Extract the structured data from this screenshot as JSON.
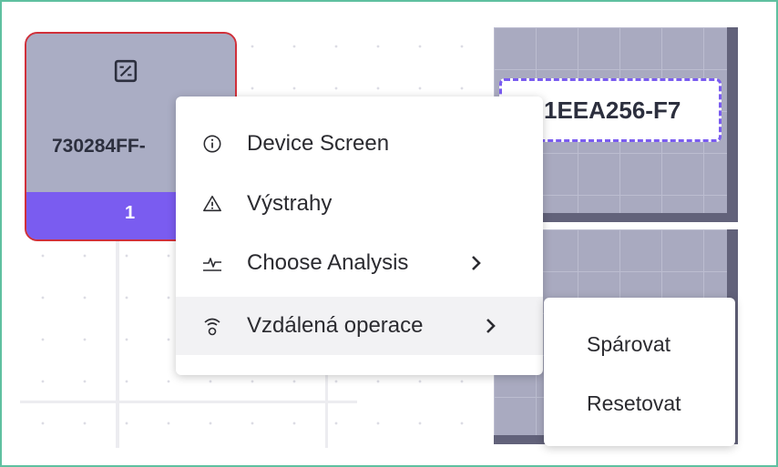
{
  "device_card": {
    "name": "730284FF-",
    "count": "1",
    "icon": "percent-box-icon"
  },
  "selected_device": {
    "label": "1EEA256-F7"
  },
  "context_menu": {
    "items": [
      {
        "label": "Device Screen",
        "icon": "info-icon"
      },
      {
        "label": "Výstrahy",
        "icon": "warning-triangle-icon"
      },
      {
        "label": "Choose Analysis",
        "icon": "analysis-pulse-icon",
        "has_submenu": true
      },
      {
        "label": "Vzdálená operace",
        "icon": "remote-signal-icon",
        "has_submenu": true
      }
    ]
  },
  "submenu": {
    "items": [
      {
        "label": "Spárovat"
      },
      {
        "label": "Resetovat"
      }
    ]
  },
  "colors": {
    "card_fill": "#aaadc4",
    "card_border": "#d0303a",
    "accent_purple": "#7a5cf0",
    "frame_border": "#5fc0a0"
  }
}
